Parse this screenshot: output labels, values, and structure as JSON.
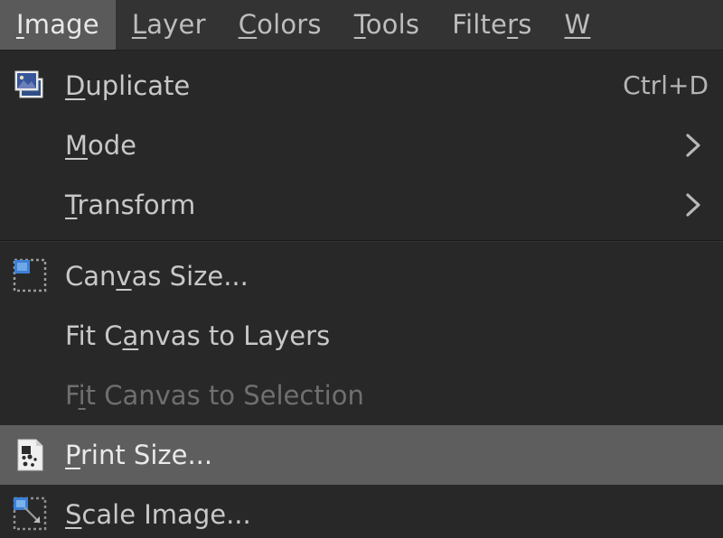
{
  "menubar": {
    "items": [
      {
        "label": "Image",
        "mnemonic": "I",
        "active": true
      },
      {
        "label": "Layer",
        "mnemonic": "L",
        "active": false
      },
      {
        "label": "Colors",
        "mnemonic": "C",
        "active": false
      },
      {
        "label": "Tools",
        "mnemonic": "T",
        "active": false
      },
      {
        "label": "Filters",
        "mnemonic": "r",
        "active": false
      },
      {
        "label": "W",
        "mnemonic": "W",
        "active": false
      }
    ]
  },
  "menu": {
    "title": "Image",
    "colors": {
      "background": "#282828",
      "menubar_background": "#333333",
      "highlight": "#5e5e5e",
      "menubar_active": "#5a5a5a",
      "text": "#c8c8c8",
      "text_disabled": "#6f6f6f",
      "icon_blue": "#3d7fd6",
      "separator": "#1c1c1c"
    },
    "items": [
      {
        "id": "duplicate",
        "label": "Duplicate",
        "mnemonic": "D",
        "accel": "Ctrl+D",
        "icon": "duplicate-image-icon",
        "submenu": false,
        "disabled": false,
        "highlighted": false
      },
      {
        "id": "mode",
        "label": "Mode",
        "mnemonic": "M",
        "accel": "",
        "icon": "",
        "submenu": true,
        "disabled": false,
        "highlighted": false
      },
      {
        "id": "transform",
        "label": "Transform",
        "mnemonic": "T",
        "accel": "",
        "icon": "",
        "submenu": true,
        "disabled": false,
        "highlighted": false
      },
      {
        "id": "canvas-size",
        "label": "Canvas Size...",
        "mnemonic": "v",
        "accel": "",
        "icon": "canvas-size-icon",
        "submenu": false,
        "disabled": false,
        "highlighted": false
      },
      {
        "id": "fit-canvas-to-layers",
        "label": "Fit Canvas to Layers",
        "mnemonic": "a",
        "accel": "",
        "icon": "",
        "submenu": false,
        "disabled": false,
        "highlighted": false
      },
      {
        "id": "fit-canvas-to-selection",
        "label": "Fit Canvas to Selection",
        "mnemonic": "i",
        "accel": "",
        "icon": "",
        "submenu": false,
        "disabled": true,
        "highlighted": false
      },
      {
        "id": "print-size",
        "label": "Print Size...",
        "mnemonic": "P",
        "accel": "",
        "icon": "print-size-icon",
        "submenu": false,
        "disabled": false,
        "highlighted": true
      },
      {
        "id": "scale-image",
        "label": "Scale Image...",
        "mnemonic": "S",
        "accel": "",
        "icon": "scale-image-icon",
        "submenu": false,
        "disabled": false,
        "highlighted": false
      }
    ],
    "separators_after": [
      "transform"
    ]
  }
}
